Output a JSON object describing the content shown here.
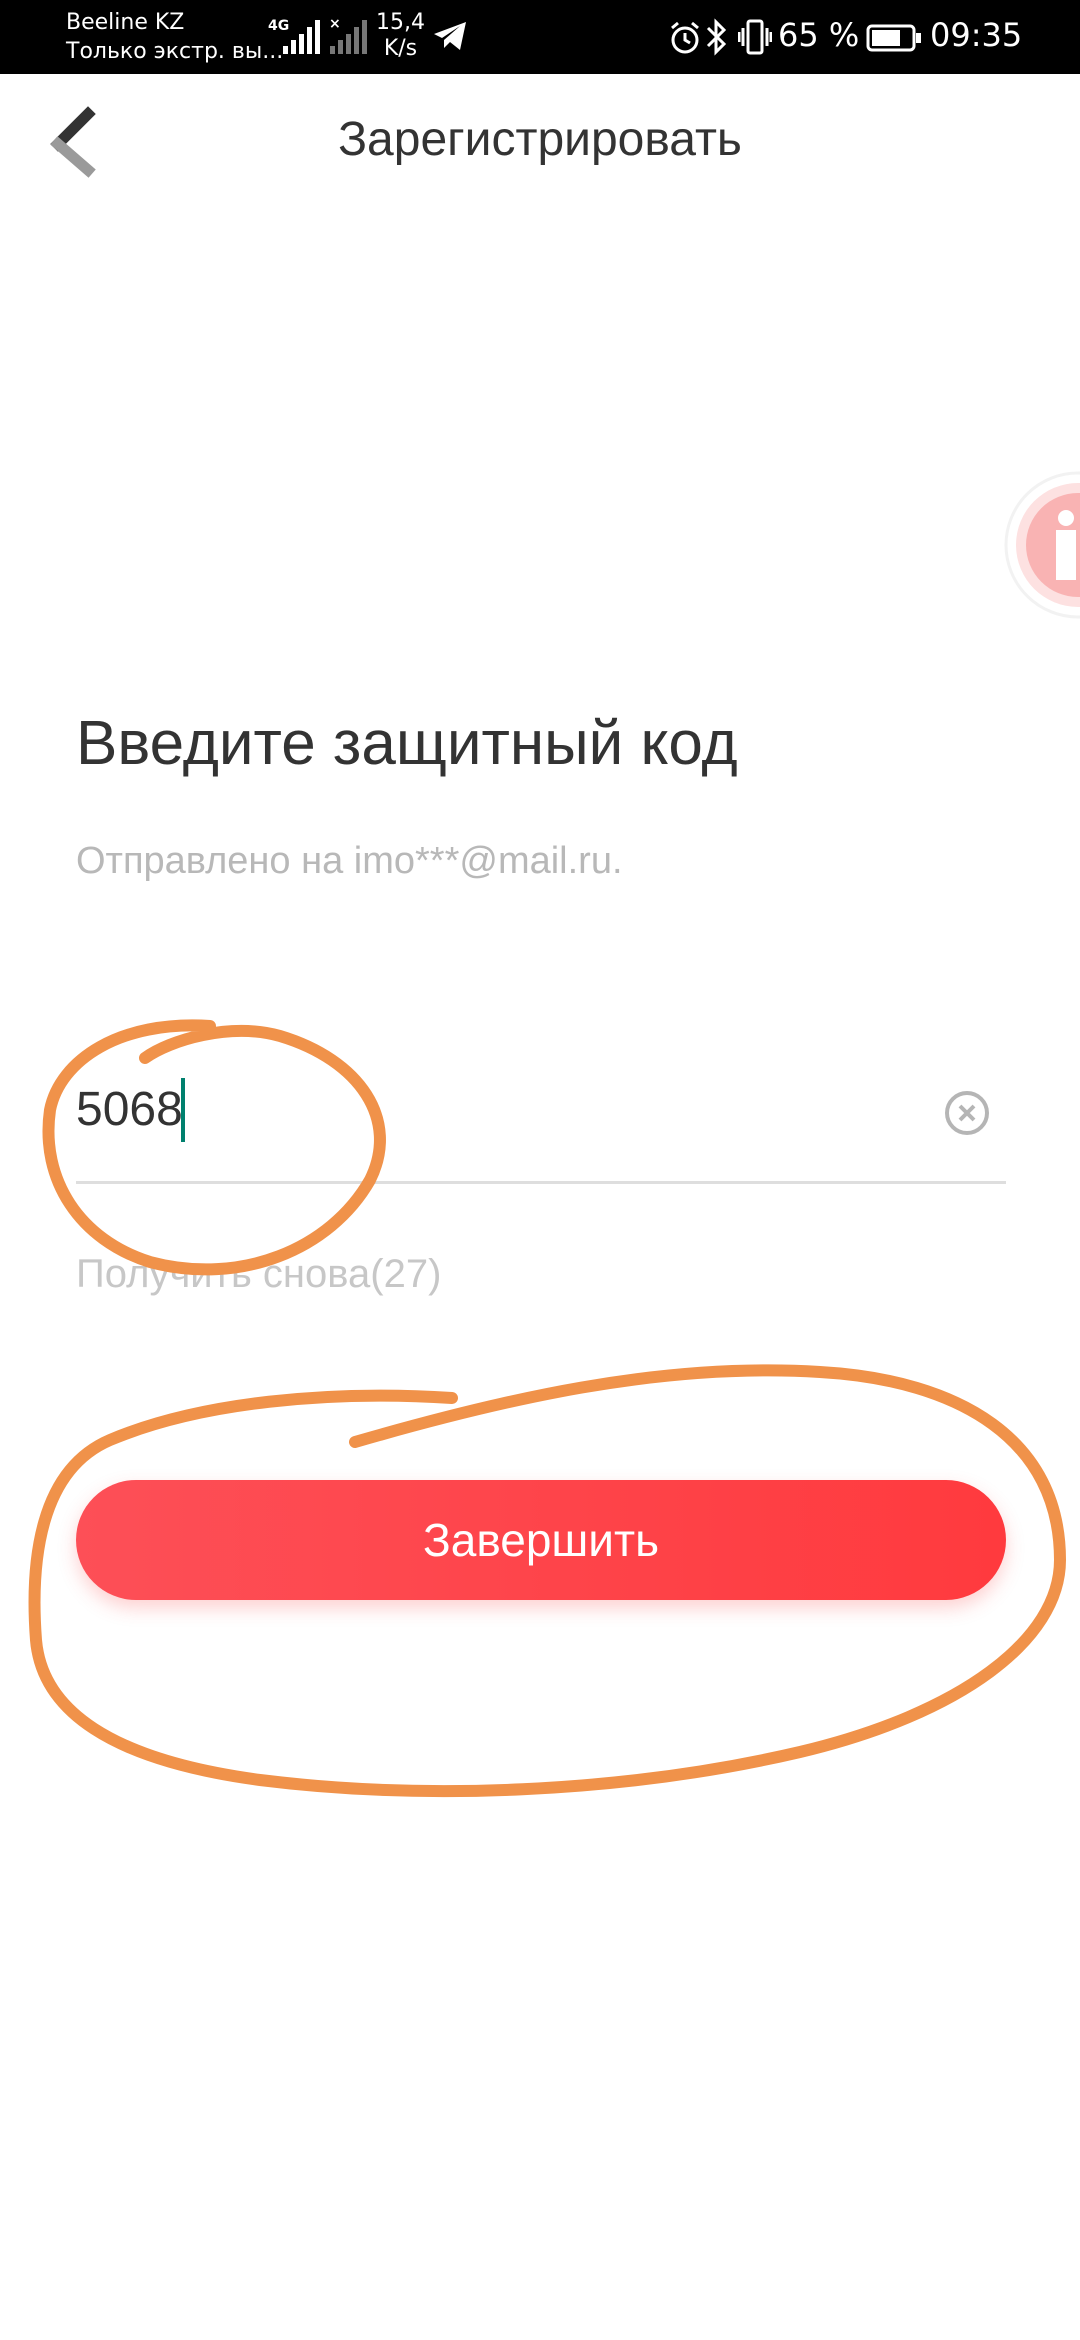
{
  "status_bar": {
    "carrier_name": "Beeline KZ",
    "carrier_status": "Только экстр. вы...",
    "network_type": "4G",
    "speed_value": "15,4",
    "speed_unit": "K/s",
    "battery_percent": "65 %",
    "time": "09:35"
  },
  "header": {
    "title": "Зарегистрировать",
    "back_icon": "chevron-left-icon"
  },
  "form": {
    "heading": "Введите защитный код",
    "sent_to": "Отправлено на imo***@mail.ru.",
    "code_value": "5068",
    "clear_icon": "clear-icon",
    "resend_label": "Получить снова(27)",
    "submit_label": "Завершить"
  },
  "colors": {
    "accent": "#fd4f57",
    "annotation": "#f0924a",
    "caret": "#00806e"
  }
}
